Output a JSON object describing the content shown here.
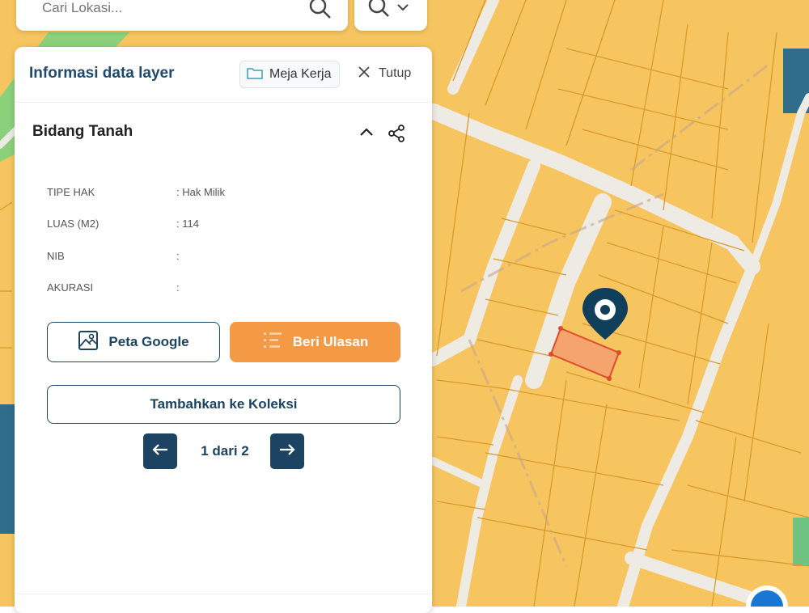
{
  "search": {
    "placeholder": "Cari Lokasi..."
  },
  "panel": {
    "title": "Informasi data layer",
    "meja_kerja_label": "Meja Kerja",
    "close_label": "Tutup",
    "section_title": "Bidang Tanah",
    "fields": [
      {
        "key": "TIPE HAK",
        "value": ": Hak Milik"
      },
      {
        "key": "LUAS (M2)",
        "value": ": 114"
      },
      {
        "key": "NIB",
        "value": ":"
      },
      {
        "key": "AKURASI",
        "value": ":"
      }
    ],
    "google_label": "Peta Google",
    "review_label": "Beri Ulasan",
    "collection_label": "Tambahkan ke Koleksi",
    "pagination": "1 dari 2"
  },
  "colors": {
    "parcel_fill": "#f7c55f",
    "parcel_border": "#d99a2b",
    "selected_fill": "#f5a46e",
    "selected_border": "#e04b2a",
    "brand_navy": "#1c4462",
    "accent_orange": "#f49a45"
  },
  "icons": [
    "search-icon",
    "zoom-icon",
    "folder-icon",
    "close-icon",
    "chevron-up-icon",
    "share-icon",
    "map-icon",
    "list-icon",
    "arrow-left-icon",
    "arrow-right-icon",
    "location-pin-icon"
  ]
}
